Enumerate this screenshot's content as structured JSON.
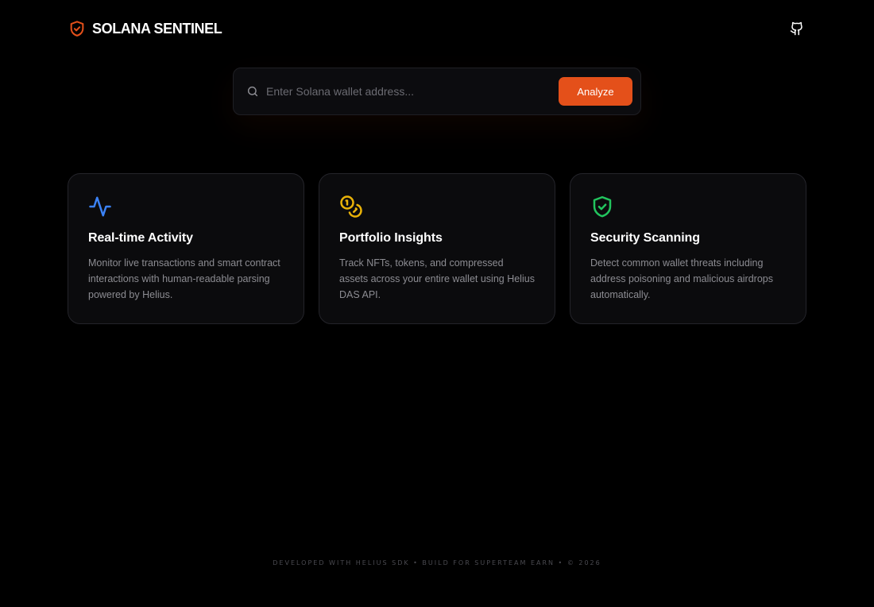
{
  "header": {
    "app_title": "SOLANA SENTINEL",
    "brand_icon": "shield-check-icon",
    "github_icon": "github-icon"
  },
  "search": {
    "placeholder": "Enter Solana wallet address...",
    "value": "",
    "button_label": "Analyze",
    "icon": "search-icon"
  },
  "cards": [
    {
      "icon": "activity-icon",
      "icon_color": "#3b82f6",
      "title": "Real-time Activity",
      "description": "Monitor live transactions and smart contract interactions with human-readable parsing powered by Helius."
    },
    {
      "icon": "coins-icon",
      "icon_color": "#eab308",
      "title": "Portfolio Insights",
      "description": "Track NFTs, tokens, and compressed assets across your entire wallet using Helius DAS API."
    },
    {
      "icon": "shield-check-icon",
      "icon_color": "#22c55e",
      "title": "Security Scanning",
      "description": "Detect common wallet threats including address poisoning and malicious airdrops automatically."
    }
  ],
  "footer": {
    "text": "DEVELOPED WITH HELIUS SDK • BUILD FOR SUPERTEAM EARN • © 2026"
  },
  "colors": {
    "accent": "#e4501a",
    "background": "#000000",
    "card_background": "#0b0b0d"
  }
}
